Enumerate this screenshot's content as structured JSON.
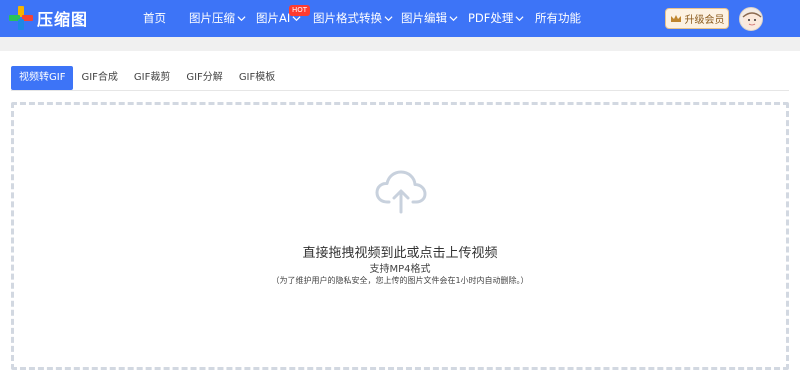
{
  "header": {
    "logo_text": "压缩图",
    "nav": [
      {
        "label": "首页"
      },
      {
        "label": "图片压缩"
      },
      {
        "label": "图片AI",
        "badge": "HOT"
      },
      {
        "label": "图片格式转换"
      },
      {
        "label": "图片编辑"
      },
      {
        "label": "PDF处理"
      },
      {
        "label": "所有功能"
      }
    ],
    "vip_label": "升级会员",
    "accent_color": "#3d74f7"
  },
  "tabs": [
    {
      "label": "视频转GIF",
      "active": true
    },
    {
      "label": "GIF合成"
    },
    {
      "label": "GIF裁剪"
    },
    {
      "label": "GIF分解"
    },
    {
      "label": "GIF模板"
    }
  ],
  "upload": {
    "icon": "cloud-upload-icon",
    "title": "直接拖拽视频到此或点击上传视频",
    "subtitle": "支持MP4格式",
    "note": "（为了维护用户的隐私安全，您上传的图片文件会在1小时内自动删除。）"
  }
}
